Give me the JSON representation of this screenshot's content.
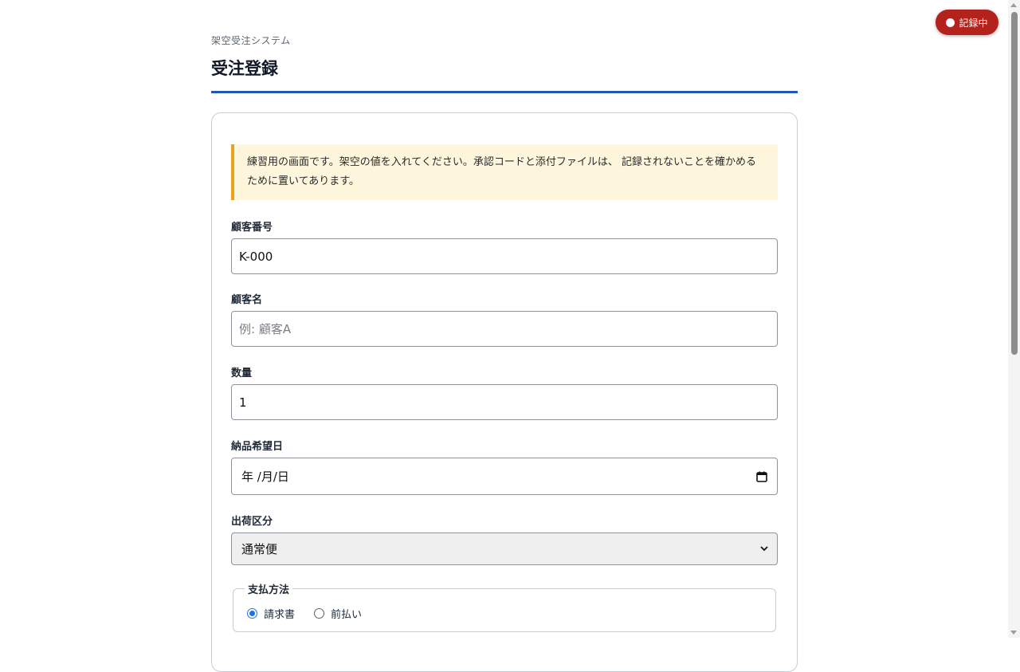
{
  "header": {
    "system_name": "架空受注システム",
    "title": "受注登録"
  },
  "recording_badge": {
    "label": "記録中"
  },
  "notice": {
    "text": "練習用の画面です。架空の値を入れてください。承認コードと添付ファイルは、 記録されないことを確かめるために置いてあります。"
  },
  "form": {
    "customer_number": {
      "label": "顧客番号",
      "value": "K-000",
      "placeholder": ""
    },
    "customer_name": {
      "label": "顧客名",
      "value": "",
      "placeholder": "例: 顧客A"
    },
    "quantity": {
      "label": "数量",
      "value": "1"
    },
    "delivery_date": {
      "label": "納品希望日",
      "value": "年 /月/日",
      "icon": "calendar-icon"
    },
    "shipping_type": {
      "label": "出荷区分",
      "selected": "通常便",
      "icon": "chevron-down-icon"
    },
    "payment_method": {
      "legend": "支払方法",
      "options": [
        {
          "label": "請求書",
          "checked": true
        },
        {
          "label": "前払い",
          "checked": false
        }
      ]
    }
  },
  "colors": {
    "accent": "#2457b5",
    "notice_bg": "#fdf6dd",
    "notice_border": "#e9a21f",
    "recording": "#b3221c",
    "radio_checked": "#1a73e8"
  }
}
